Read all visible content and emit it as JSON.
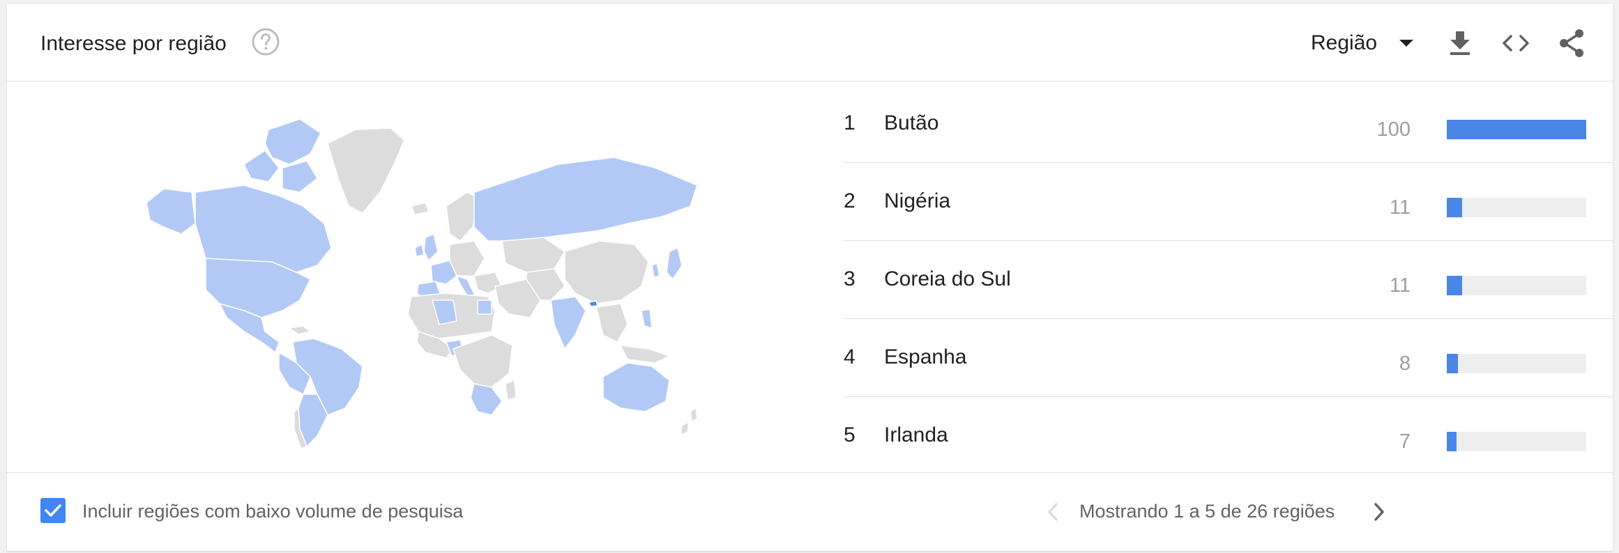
{
  "header": {
    "title": "Interesse por região",
    "help_icon": "help-circle-icon",
    "region_select": {
      "selected": "Região",
      "icon": "caret-down-icon"
    },
    "tools": [
      {
        "name": "download-icon"
      },
      {
        "name": "embed-code-icon"
      },
      {
        "name": "share-icon"
      }
    ]
  },
  "colors": {
    "accent": "#4a86e8",
    "checkbox": "#4285f4",
    "map_active": "#b3c9f5",
    "map_inactive": "#dcdcdc",
    "bar_track": "#eeeeee",
    "value_text": "#9e9e9e"
  },
  "regions": [
    {
      "rank": "1",
      "name": "Butão",
      "value": 100
    },
    {
      "rank": "2",
      "name": "Nigéria",
      "value": 11
    },
    {
      "rank": "3",
      "name": "Coreia do Sul",
      "value": 11
    },
    {
      "rank": "4",
      "name": "Espanha",
      "value": 8
    },
    {
      "rank": "5",
      "name": "Irlanda",
      "value": 7
    }
  ],
  "footer": {
    "checkbox_checked": true,
    "checkbox_label": "Incluir regiões com baixo volume de pesquisa",
    "pager_text": "Mostrando 1 a 5 de 26 regiões"
  }
}
